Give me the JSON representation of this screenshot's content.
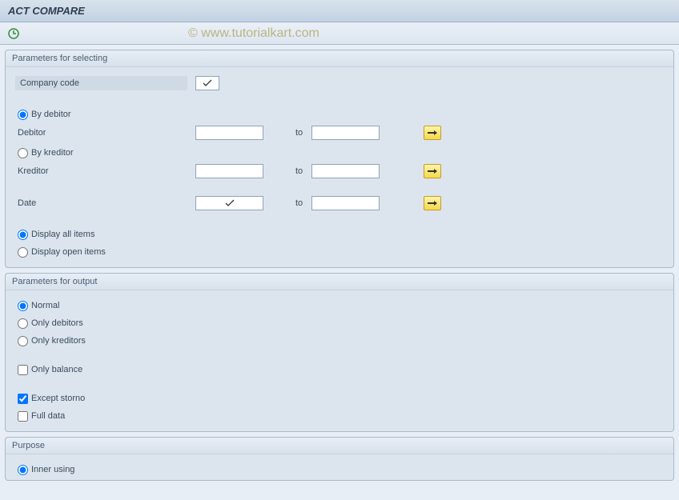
{
  "header": {
    "title": "ACT COMPARE"
  },
  "watermark": "© www.tutorialkart.com",
  "groups": {
    "selecting": {
      "title": "Parameters for selecting",
      "company_code_label": "Company code",
      "company_code_value": "",
      "by_debitor_label": "By debitor",
      "debitor_label": "Debitor",
      "debitor_from": "",
      "to_label": "to",
      "debitor_to": "",
      "by_kreditor_label": "By kreditor",
      "kreditor_label": "Kreditor",
      "kreditor_from": "",
      "kreditor_to": "",
      "date_label": "Date",
      "date_from": "",
      "date_to": "",
      "display_all_label": "Display all items",
      "display_open_label": "Display open items"
    },
    "output": {
      "title": "Parameters for output",
      "normal_label": "Normal",
      "only_debitors_label": "Only debitors",
      "only_kreditors_label": "Only kreditors",
      "only_balance_label": "Only balance",
      "except_storno_label": "Except storno",
      "full_data_label": "Full data"
    },
    "purpose": {
      "title": "Purpose",
      "inner_using_label": "Inner using"
    }
  }
}
